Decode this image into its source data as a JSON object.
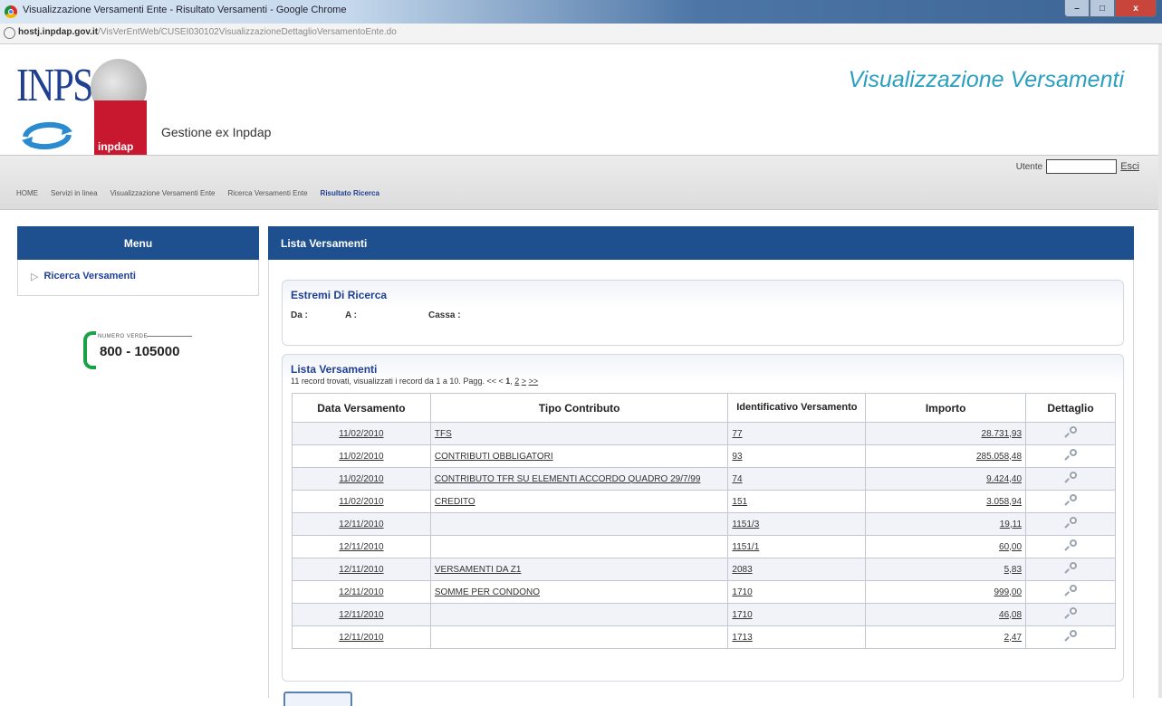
{
  "window": {
    "title": "Visualizzazione Versamenti Ente - Risultato Versamenti - Google Chrome",
    "url_host": "hostj.inpdap.gov.it",
    "url_path": "/VisVerEntWeb/CUSEI030102VisualizzazioneDettaglioVersamentoEnte.do",
    "minimize": "–",
    "maximize": "□",
    "close": "x"
  },
  "header": {
    "logo_inps": "INPS",
    "logo_inpdap": "inpdap",
    "gestione": "Gestione ex Inpdap",
    "app_title": "Visualizzazione Versamenti"
  },
  "user": {
    "label": "Utente",
    "value": "",
    "exit": "Esci"
  },
  "breadcrumb": [
    "HOME",
    "Servizi in linea",
    "Visualizzazione Versamenti Ente",
    "Ricerca Versamenti Ente",
    "Risultato Ricerca"
  ],
  "menu": {
    "title": "Menu",
    "items": [
      {
        "arrow": "▷",
        "label": "Ricerca Versamenti"
      }
    ]
  },
  "green_number": {
    "label": "NUMERO VERDE",
    "number": "800 - 105000"
  },
  "main": {
    "title": "Lista Versamenti",
    "search_box": {
      "title": "Estremi Di Ricerca",
      "da_label": "Da :",
      "a_label": "A :",
      "cassa_label": "Cassa :"
    },
    "list_box": {
      "title": "Lista Versamenti",
      "info": "11 record trovati, visualizzati i record da 1 a 10. Pagg. << < ",
      "page_current": "1",
      "page_sep": ", ",
      "page_next": "2",
      "nav_next": ">",
      "nav_last": ">>"
    },
    "columns": {
      "date": "Data Versamento",
      "type": "Tipo Contributo",
      "id": "Identificativo Versamento",
      "amount": "Importo",
      "detail": "Dettaglio"
    },
    "rows": [
      {
        "date": "11/02/2010",
        "type": "TFS",
        "id": "77",
        "amount": "28.731,93"
      },
      {
        "date": "11/02/2010",
        "type": "CONTRIBUTI OBBLIGATORI",
        "id": "93",
        "amount": "285.058,48"
      },
      {
        "date": "11/02/2010",
        "type": "CONTRIBUTO TFR SU ELEMENTI ACCORDO QUADRO 29/7/99",
        "id": "74",
        "amount": "9.424,40"
      },
      {
        "date": "11/02/2010",
        "type": "CREDITO",
        "id": "151",
        "amount": "3.058,94"
      },
      {
        "date": "12/11/2010",
        "type": "",
        "id": "1151/3",
        "amount": "19,11"
      },
      {
        "date": "12/11/2010",
        "type": "",
        "id": "1151/1",
        "amount": "60,00"
      },
      {
        "date": "12/11/2010",
        "type": "VERSAMENTI DA Z1",
        "id": "2083",
        "amount": "5,83"
      },
      {
        "date": "12/11/2010",
        "type": "SOMME PER CONDONO",
        "id": "1710",
        "amount": "999,00"
      },
      {
        "date": "12/11/2010",
        "type": "",
        "id": "1710",
        "amount": "46,08"
      },
      {
        "date": "12/11/2010",
        "type": "",
        "id": "1713",
        "amount": "2,47"
      }
    ]
  }
}
